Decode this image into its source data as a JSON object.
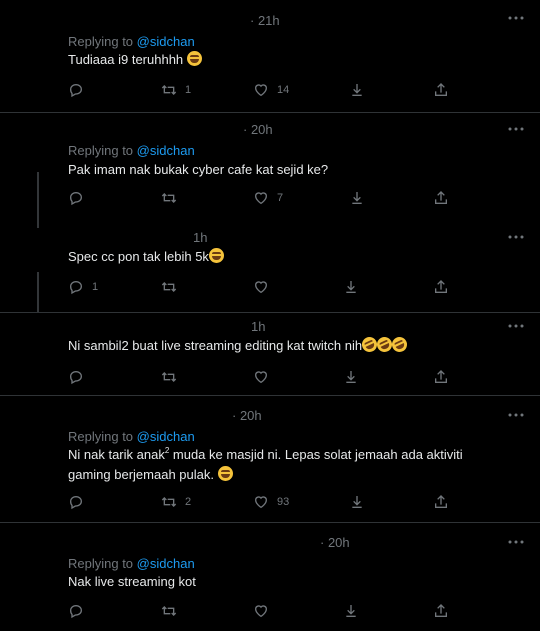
{
  "tweets": [
    {
      "time": "· 21h",
      "replying_prefix": "Replying to",
      "replying_handle": "@sidchan",
      "text": "Tudiaaa i9 teruhhhh",
      "emoji": "joy",
      "reply_count": "",
      "retweet_count": "1",
      "like_count": "14"
    },
    {
      "time": "· 20h",
      "replying_prefix": "Replying to",
      "replying_handle": "@sidchan",
      "text": "Pak imam nak bukak cyber cafe kat sejid ke?",
      "reply_count": "",
      "retweet_count": "",
      "like_count": "7"
    },
    {
      "time": "1h",
      "text": "Spec cc pon tak lebih 5k",
      "emoji": "joy",
      "reply_count": "1",
      "retweet_count": "",
      "like_count": ""
    },
    {
      "time": "1h",
      "text": "Ni sambil2 buat live streaming editing  kat twitch nih",
      "emoji": "rofl x3",
      "reply_count": "",
      "retweet_count": "",
      "like_count": ""
    },
    {
      "time": "· 20h",
      "replying_prefix": "Replying to",
      "replying_handle": "@sidchan",
      "text_part1": "Ni nak tarik anak",
      "text_sup": "2",
      "text_part2": " muda ke masjid ni. Lepas solat jemaah ada aktiviti gaming berjemaah pulak.",
      "emoji": "joy",
      "reply_count": "",
      "retweet_count": "2",
      "like_count": "93"
    },
    {
      "time": "· 20h",
      "replying_prefix": "Replying to",
      "replying_handle": "@sidchan",
      "text": "Nak live streaming kot",
      "reply_count": "",
      "retweet_count": "",
      "like_count": ""
    }
  ],
  "icons": [
    "more-icon",
    "reply-icon",
    "retweet-icon",
    "like-icon",
    "share-tweet-icon",
    "share-icon"
  ],
  "colors": {
    "background": "#000000",
    "text": "#e7e9ea",
    "muted": "#71767b",
    "accent": "#1d9bf0",
    "divider": "#2f3336"
  }
}
